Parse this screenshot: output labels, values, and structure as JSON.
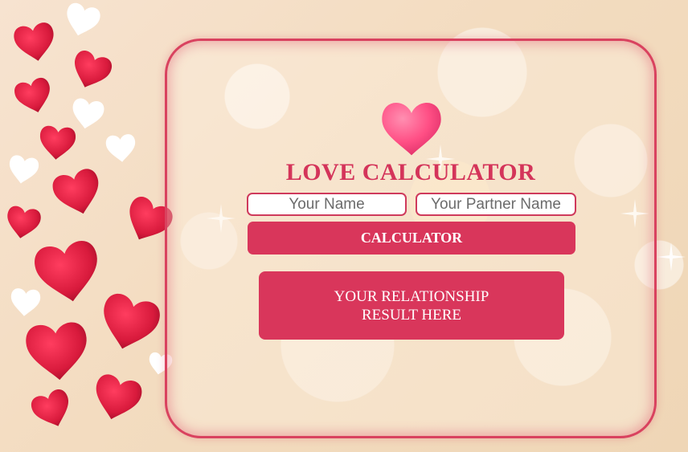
{
  "app": {
    "title": "LOVE CALCULATOR",
    "logo_icon": "heart-icon"
  },
  "form": {
    "name_placeholder": "Your Name",
    "partner_placeholder": "Your Partner Name",
    "name_value": "",
    "partner_value": "",
    "button_label": "CALCULATOR"
  },
  "result": {
    "line1": "YOUR RELATIONSHIP",
    "line2": "RESULT HERE"
  },
  "colors": {
    "accent": "#d9365b",
    "title": "#d4345a",
    "border": "#d9425f",
    "heart_red": "#e02346",
    "heart_pink": "#ff5a8a"
  }
}
